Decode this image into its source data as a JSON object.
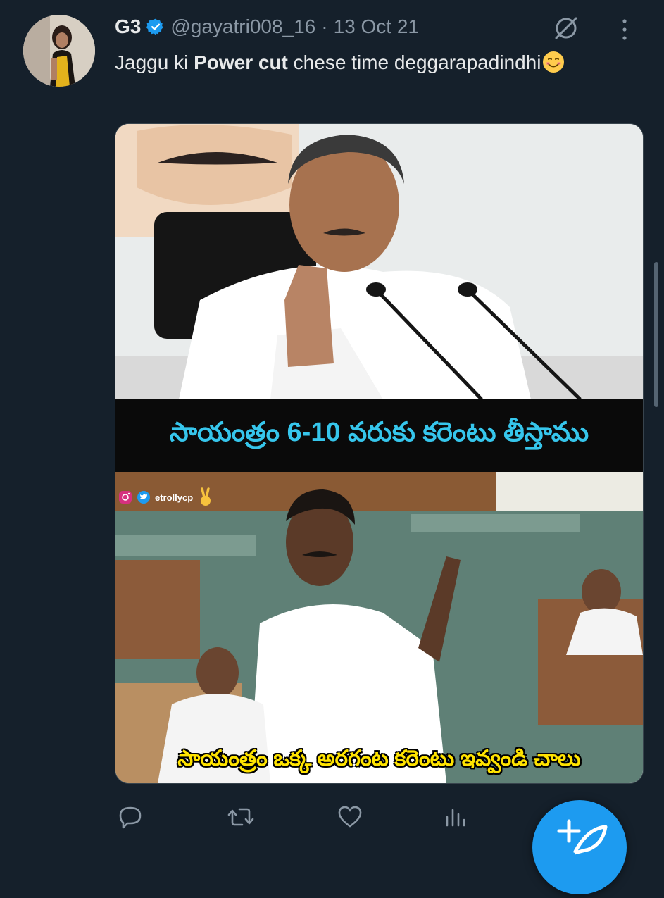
{
  "tweet": {
    "author_name": "G3",
    "handle": "@gayatri008_16",
    "separator": "·",
    "date": "13 Oct 21",
    "text_before": "Jaggu ki ",
    "text_bold": "Power cut",
    "text_after": " chese time deggarapadindhi"
  },
  "media": {
    "caption_top": "సాయంత్రం 6-10 వరుకు కరెంటు తీస్తాము",
    "watermark": "etrollycp",
    "caption_bottom": "సాయంత్రం ఒక్క అరగంట కరెంటు ఇవ్వండి చాలు"
  },
  "icons": {
    "verified": "verified-badge-icon",
    "grok": "grok-icon",
    "more": "more-vertical-icon",
    "reply": "reply-icon",
    "retweet": "retweet-icon",
    "like": "like-icon",
    "views": "views-icon",
    "compose": "compose-fab-icon"
  },
  "colors": {
    "background": "#15202b",
    "accent": "#1d9bf0",
    "caption_top_text": "#36c6ec",
    "caption_bottom_text": "#ffe300"
  }
}
